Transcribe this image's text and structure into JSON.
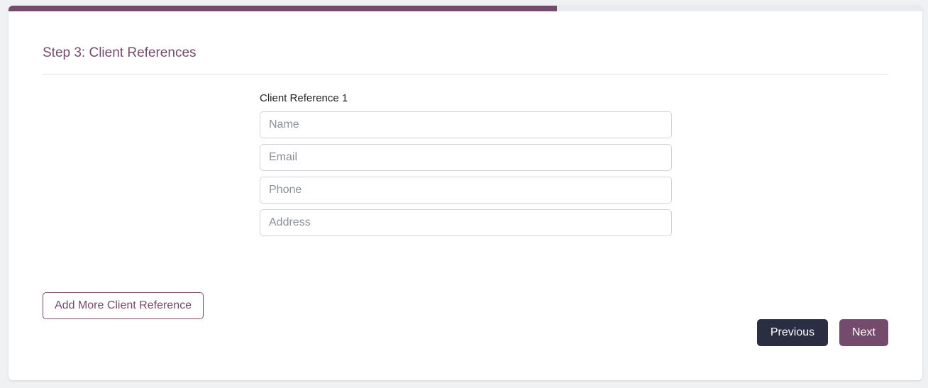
{
  "progress": {
    "fraction": 0.6
  },
  "form": {
    "step_title": "Step 3: Client References",
    "reference_label": "Client Reference 1",
    "fields": {
      "name_placeholder": "Name",
      "email_placeholder": "Email",
      "phone_placeholder": "Phone",
      "address_placeholder": "Address"
    }
  },
  "actions": {
    "add_more_label": "Add More Client Reference",
    "previous_label": "Previous",
    "next_label": "Next"
  },
  "colors": {
    "accent": "#744b6c",
    "dark": "#2b2d42",
    "border": "#ced4da"
  }
}
